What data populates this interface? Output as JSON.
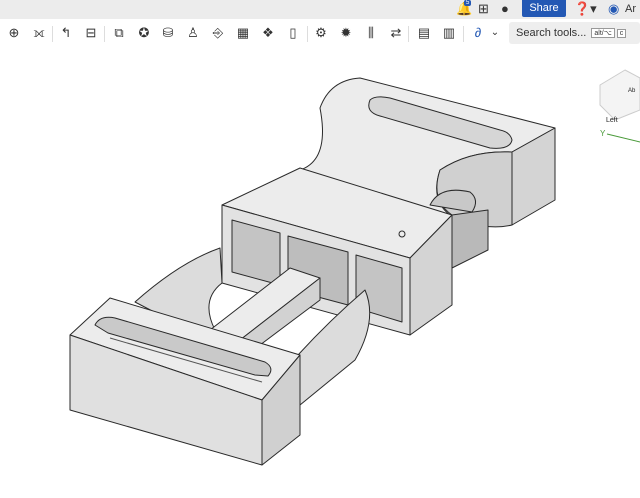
{
  "topbar": {
    "notifications_count": "5",
    "share_label": "Share",
    "user_initials": "Ar",
    "icons": [
      "bell-icon",
      "app-store-icon",
      "learning-icon",
      "help-icon",
      "user-avatar-icon"
    ]
  },
  "toolbar": {
    "tools": [
      "view-cube-tool",
      "mate-connector",
      "mirror",
      "dimension",
      "transform",
      "insert",
      "replicate",
      "sketch",
      "split",
      "section",
      "gears",
      "flatten",
      "pattern",
      "assembly",
      "explode",
      "relations",
      "drawing",
      "bom",
      "curve"
    ],
    "search_label": "Search tools...",
    "shortcut_1": "alt/⌥",
    "shortcut_2": "c"
  },
  "viewcube": {
    "face_left": "Left",
    "face_top": "Ab",
    "axis_y": "Y"
  },
  "colors": {
    "accent": "#2358b4",
    "model_top": "#ececec",
    "model_side": "#d4d4d4",
    "model_dark": "#a9a9a9",
    "edge": "#2a2a2a"
  }
}
